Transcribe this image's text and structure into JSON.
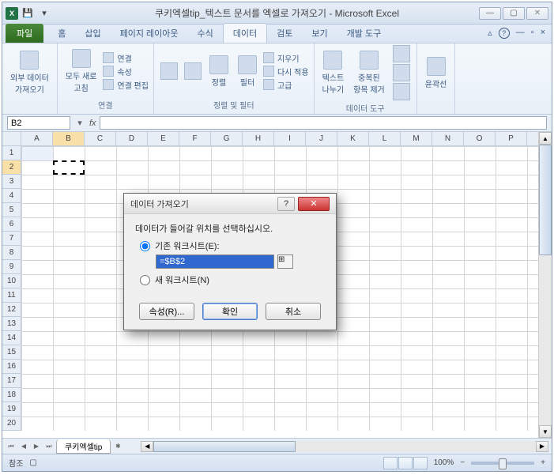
{
  "title": "쿠키엑셀tip_텍스트 문서를 엑셀로 가져오기 - Microsoft Excel",
  "tabs": {
    "file": "파일",
    "items": [
      "홈",
      "삽입",
      "페이지 레이아웃",
      "수식",
      "데이터",
      "검토",
      "보기",
      "개발 도구"
    ],
    "activeIndex": 4
  },
  "ribbon": {
    "g0": {
      "big": "외부 데이터\n가져오기"
    },
    "g1": {
      "label": "연결",
      "big": "모두 새로\n고침",
      "items": [
        "연결",
        "속성",
        "연결 편집"
      ]
    },
    "g2": {
      "label": "정렬 및 필터",
      "sort": "정렬",
      "filter": "필터",
      "items": [
        "지우기",
        "다시 적용",
        "고급"
      ]
    },
    "g3": {
      "label": "데이터 도구",
      "b1": "텍스트\n나누기",
      "b2": "중복된\n항목 제거"
    },
    "g4": {
      "big": "윤곽선"
    }
  },
  "nameBox": "B2",
  "columns": [
    "A",
    "B",
    "C",
    "D",
    "E",
    "F",
    "G",
    "H",
    "I",
    "J",
    "K",
    "L",
    "M",
    "N",
    "O",
    "P"
  ],
  "rows": [
    "1",
    "2",
    "3",
    "4",
    "5",
    "6",
    "7",
    "8",
    "9",
    "10",
    "11",
    "12",
    "13",
    "14",
    "15",
    "16",
    "17",
    "18",
    "19",
    "20"
  ],
  "sheetTab": "쿠키엑셀tip",
  "status": {
    "mode": "참조",
    "zoom": "100%"
  },
  "dialog": {
    "title": "데이터 가져오기",
    "prompt": "데이터가 들어갈 위치를 선택하십시오.",
    "opt1": "기존 워크시트(E):",
    "ref": "=$B$2",
    "opt2": "새 워크시트(N)",
    "props": "속성(R)...",
    "ok": "확인",
    "cancel": "취소"
  }
}
